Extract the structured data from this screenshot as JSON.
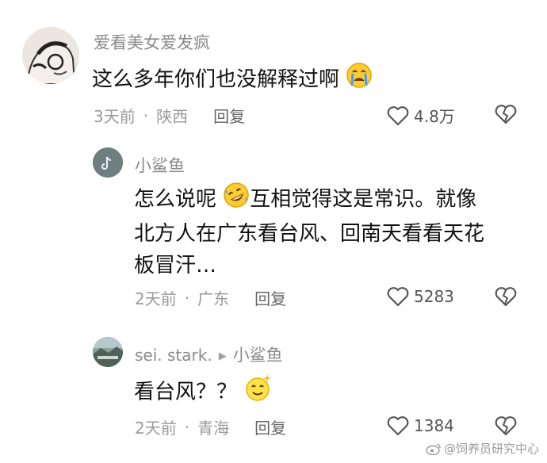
{
  "comments": [
    {
      "user": "爱看美女爱发疯",
      "text": "这么多年你们也没解释过啊",
      "emoji": "crying-face",
      "time": "3天前",
      "location": "陕西",
      "reply_label": "回复",
      "likes": "4.8万"
    },
    {
      "user": "小鲨鱼",
      "text_1": "怎么说呢",
      "emoji": "rofl-face",
      "text_2": "互相觉得这是常识。就像",
      "line2": "北方人在广东看台风、回南天看看天花",
      "line3": "板冒汗…",
      "time": "2天前",
      "location": "广东",
      "reply_label": "回复",
      "likes": "5283"
    },
    {
      "user": "sei. stark.",
      "reply_to": "小鲨鱼",
      "text": "看台风？？",
      "emoji": "sparkle-smile-face",
      "time": "2天前",
      "location": "青海",
      "reply_label": "回复",
      "likes": "1384"
    }
  ],
  "watermark": "@饲养员研究中心"
}
